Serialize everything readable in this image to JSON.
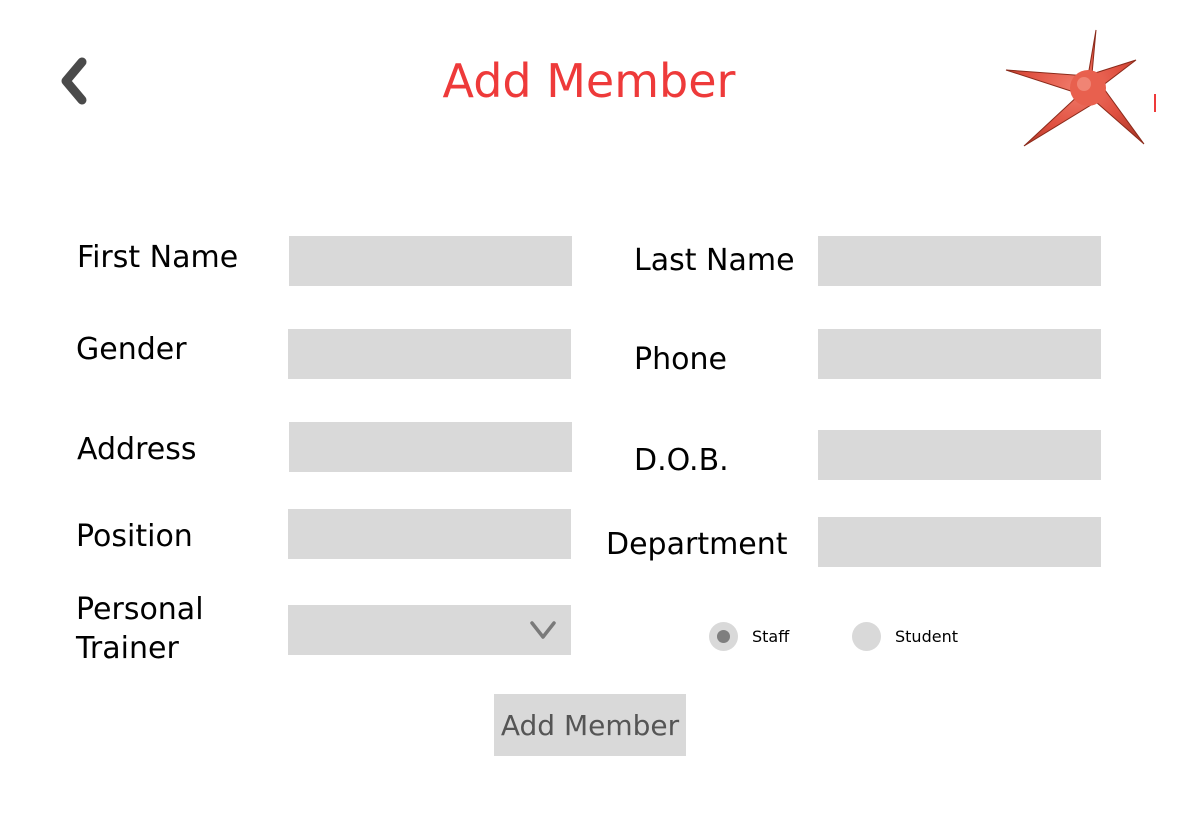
{
  "header": {
    "title": "Add Member",
    "back_icon": "chevron-left-icon",
    "logo_icon": "red-star-logo",
    "title_color": "#ee3a3a"
  },
  "form": {
    "first_name": {
      "label": "First Name",
      "value": ""
    },
    "last_name": {
      "label": "Last Name",
      "value": ""
    },
    "gender": {
      "label": "Gender",
      "value": ""
    },
    "phone": {
      "label": "Phone",
      "value": ""
    },
    "address": {
      "label": "Address",
      "value": ""
    },
    "dob": {
      "label": "D.O.B.",
      "value": ""
    },
    "position": {
      "label": "Position",
      "value": ""
    },
    "department": {
      "label": "Department",
      "value": ""
    },
    "personal_trainer": {
      "label_line1": "Personal",
      "label_line2": "Trainer",
      "selected": ""
    },
    "member_type": {
      "options": [
        "Staff",
        "Student"
      ],
      "selected": "Staff"
    }
  },
  "actions": {
    "submit_label": "Add Member"
  }
}
